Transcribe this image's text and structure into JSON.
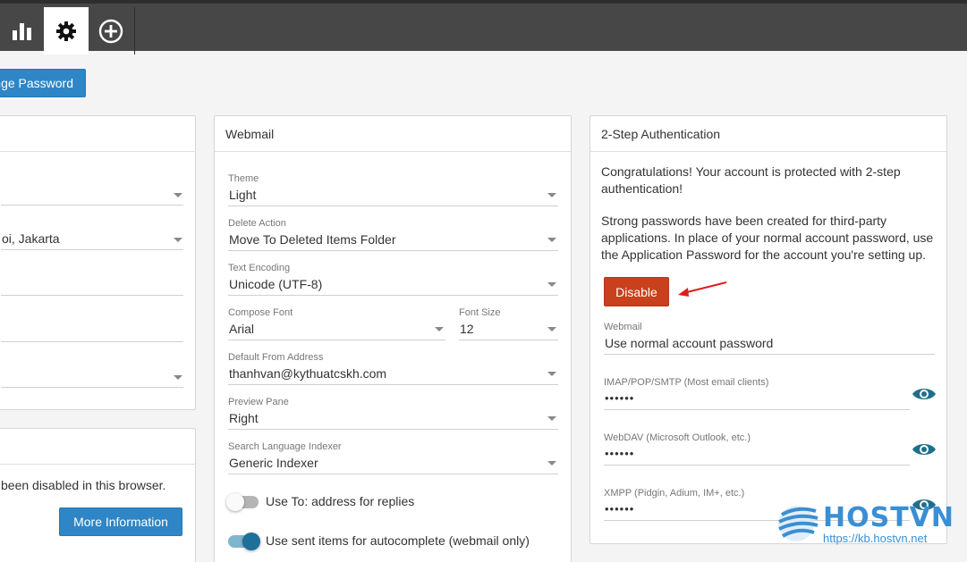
{
  "toolbar": {
    "tabs": [
      {
        "icon": "bar-chart-icon"
      },
      {
        "icon": "gear-icon",
        "active": true
      },
      {
        "icon": "plus-circle-icon"
      }
    ]
  },
  "change_password_label": "nge Password",
  "left_panel": {
    "fields": [
      {
        "value": ""
      },
      {
        "value": "oi, Jakarta"
      },
      {
        "value": ""
      },
      {
        "value": ""
      },
      {
        "value": ""
      }
    ]
  },
  "left_bottom_panel": {
    "text": "been disabled in this browser.",
    "button_label": "More Information"
  },
  "webmail": {
    "title": "Webmail",
    "theme": {
      "label": "Theme",
      "value": "Light"
    },
    "delete_action": {
      "label": "Delete Action",
      "value": "Move To Deleted Items Folder"
    },
    "text_encoding": {
      "label": "Text Encoding",
      "value": "Unicode (UTF-8)"
    },
    "compose_font": {
      "label": "Compose Font",
      "value": "Arial"
    },
    "font_size": {
      "label": "Font Size",
      "value": "12"
    },
    "from_address": {
      "label": "Default From Address",
      "value": "thanhvan@kythuatcskh.com"
    },
    "preview_pane": {
      "label": "Preview Pane",
      "value": "Right"
    },
    "search_indexer": {
      "label": "Search Language Indexer",
      "value": "Generic Indexer"
    },
    "toggle_reply": {
      "label": "Use To: address for replies",
      "on": false
    },
    "toggle_autocomplete": {
      "label": "Use sent items for autocomplete (webmail only)",
      "on": true
    }
  },
  "two_step": {
    "title": "2-Step Authentication",
    "congrats_line1": "Congratulations! Your account is protected with 2-step",
    "congrats_line2": "authentication!",
    "info_line1": "Strong passwords have been created for third-party",
    "info_line2": "applications. In place of your normal account password, use",
    "info_line3": "the Application Password for the account you're setting up.",
    "disable_label": "Disable",
    "webmail": {
      "label": "Webmail",
      "value": "Use normal account password"
    },
    "imap": {
      "label": "IMAP/POP/SMTP (Most email clients)",
      "value": "••••••"
    },
    "webdav": {
      "label": "WebDAV (Microsoft Outlook, etc.)",
      "value": "••••••"
    },
    "xmpp": {
      "label": "XMPP (Pidgin, Adium, IM+, etc.)",
      "value": "••••••"
    }
  },
  "watermark": {
    "brand": "HOSTVN",
    "url": "https://kb.hostvn.net"
  },
  "colors": {
    "accent_blue": "#2e86c6",
    "danger_red": "#c9401d",
    "eye_teal": "#1f6f8b",
    "toolbar_dark": "#474747"
  }
}
